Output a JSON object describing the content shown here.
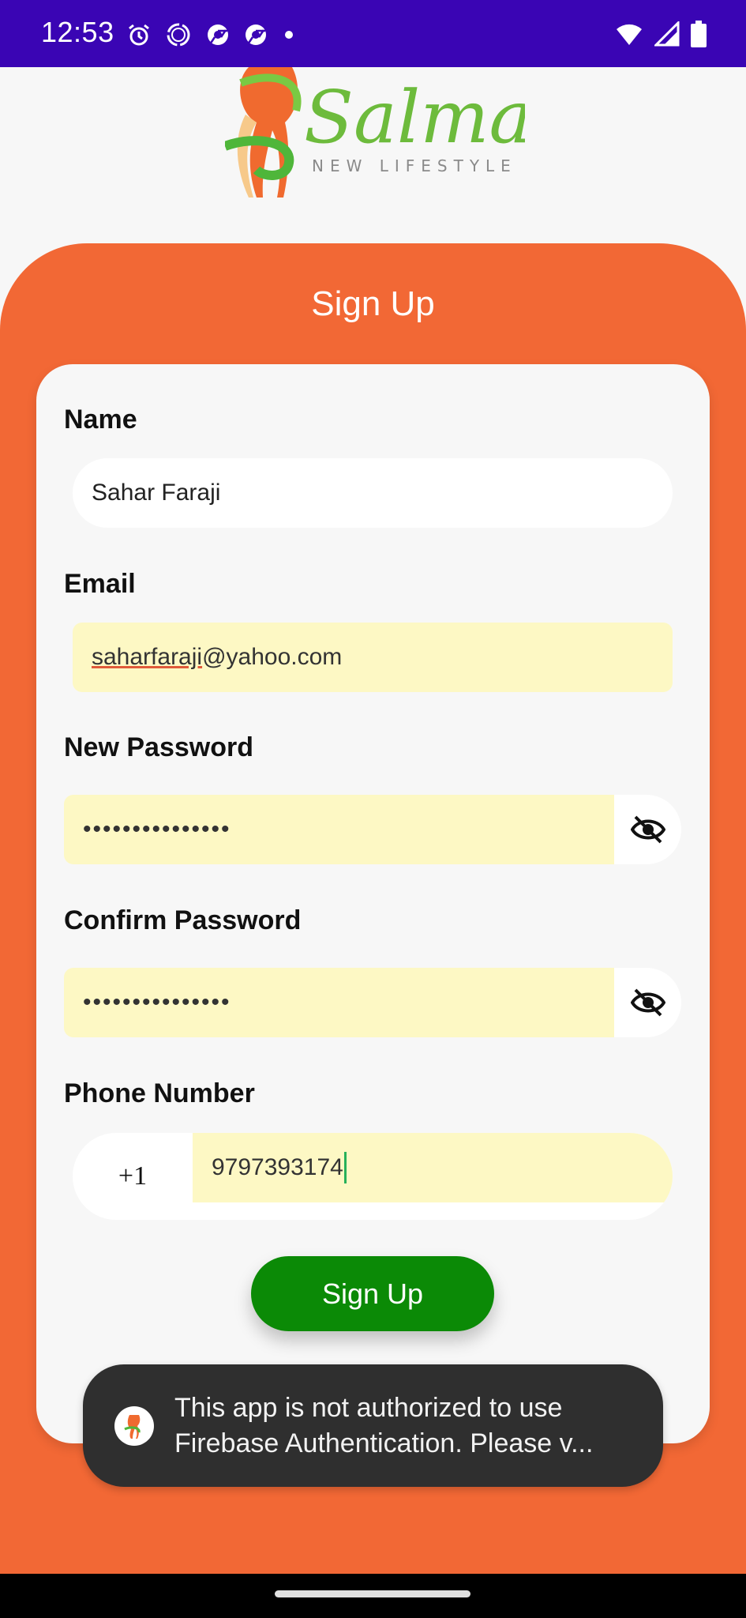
{
  "status_bar": {
    "time": "12:53",
    "left_icons": [
      "alarm-icon",
      "sync-icon",
      "chrome-icon",
      "chrome-icon",
      "dot-icon"
    ],
    "right_icons": [
      "wifi-icon",
      "signal-icon",
      "battery-icon"
    ]
  },
  "logo": {
    "brand": "Salma",
    "tagline": "NEW LIFESTYLE"
  },
  "form": {
    "title": "Sign Up",
    "name": {
      "label": "Name",
      "value": "Sahar Faraji"
    },
    "email": {
      "label": "Email",
      "value_underlined": "saharfaraji",
      "value_rest": "@yahoo.com"
    },
    "new_password": {
      "label": "New Password",
      "value": "•••••••••••••••",
      "toggle_icon": "eye-off-icon"
    },
    "confirm_password": {
      "label": "Confirm Password",
      "value": "•••••••••••••••",
      "toggle_icon": "eye-off-icon"
    },
    "phone": {
      "label": "Phone Number",
      "country_code": "+1",
      "value": "9797393174"
    },
    "submit_label": "Sign Up"
  },
  "toast": {
    "message": "This app is not authorized to use\nFirebase Authentication. Please v..."
  },
  "colors": {
    "status_bar": "#3a05b4",
    "panel": "#f26835",
    "button": "#0b8a06",
    "autofill": "#fdf8c4",
    "toast": "#2f2f2f"
  }
}
